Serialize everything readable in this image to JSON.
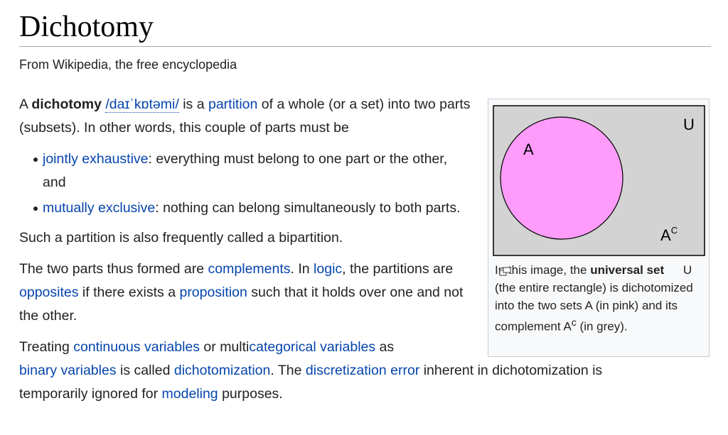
{
  "title": "Dichotomy",
  "tagline": "From Wikipedia, the free encyclopedia",
  "intro": {
    "t1": "A ",
    "term": "dichotomy",
    "t2": " ",
    "ipa": "/daɪˈkɒtəmi/",
    "t3": " is a ",
    "link_partition": "partition",
    "t4": " of a whole (or a set) into two parts (subsets). In other words, this couple of parts must be"
  },
  "bullets": [
    {
      "link": "jointly exhaustive",
      "text": ": everything must belong to one part or the other, and"
    },
    {
      "link": "mutually exclusive",
      "text": ": nothing can belong simultaneously to both parts."
    }
  ],
  "para2": "Such a partition is also frequently called a bipartition.",
  "para3": {
    "t1": "The two parts thus formed are ",
    "link_complements": "complements",
    "t2": ". In ",
    "link_logic": "logic",
    "t3": ", the partitions are ",
    "link_opposites": "opposites",
    "t4": " if there exists a ",
    "link_proposition": "proposition",
    "t5": " such that it holds over one and not the other."
  },
  "para4": {
    "t1": "Treating ",
    "link_continuous": "continuous variables",
    "t2": " or multi",
    "link_categorical": "categorical variables",
    "t3": " as ",
    "link_binary": "binary variables",
    "t4": " is called ",
    "link_dichotomization": "dichotomization",
    "t5": ". The ",
    "link_discretization": "discretization error",
    "t6": " inherent in dichotomization is temporarily ignored for ",
    "link_modeling": "modeling",
    "t7": " purposes."
  },
  "figure": {
    "label_u": "U",
    "label_a": "A",
    "label_ac_base": "A",
    "label_ac_sup": "C",
    "colors": {
      "universe": "#d3d3d3",
      "set_a": "#ff9cfb"
    }
  },
  "caption": {
    "t1": "In this image, the ",
    "bold": "universal set",
    "t2": " U (the entire rectangle) is dichotomized into the two sets A (in pink) and its complement A",
    "sup": "c",
    "t3": " (in grey)."
  }
}
